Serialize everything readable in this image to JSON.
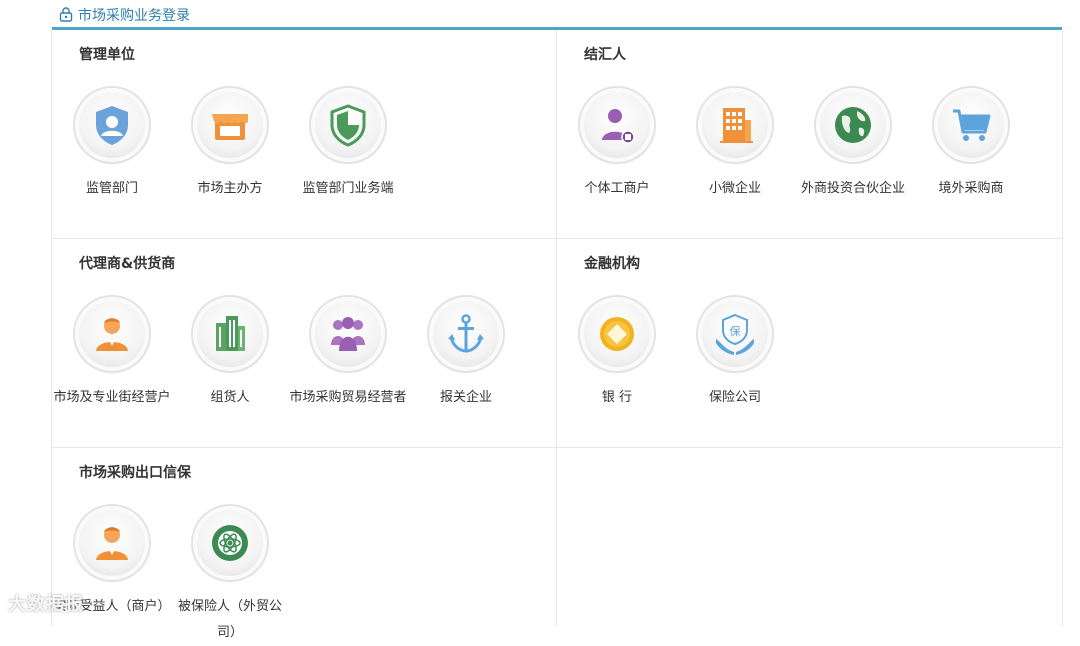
{
  "header": {
    "title": "市场采购业务登录",
    "icon": "lock-icon"
  },
  "sections": {
    "management": {
      "title": "管理单位",
      "items": [
        {
          "label": "监管部门",
          "icon": "shield-user-icon"
        },
        {
          "label": "市场主办方",
          "icon": "storefront-icon"
        },
        {
          "label": "监管部门业务端",
          "icon": "shield-check-icon"
        }
      ]
    },
    "settlement": {
      "title": "结汇人",
      "items": [
        {
          "label": "个体工商户",
          "icon": "businessperson-icon"
        },
        {
          "label": "小微企业",
          "icon": "building-icon"
        },
        {
          "label": "外商投资合伙企业",
          "icon": "globe-icon"
        },
        {
          "label": "境外采购商",
          "icon": "shopping-cart-icon"
        }
      ]
    },
    "agents": {
      "title": "代理商&供货商",
      "items": [
        {
          "label": "市场及专业街经营户",
          "icon": "person-icon"
        },
        {
          "label": "组货人",
          "icon": "office-tower-icon"
        },
        {
          "label": "市场采购贸易经营者",
          "icon": "group-icon"
        },
        {
          "label": "报关企业",
          "icon": "anchor-icon"
        }
      ]
    },
    "finance": {
      "title": "金融机构",
      "items": [
        {
          "label": "银 行",
          "icon": "coin-icon"
        },
        {
          "label": "保险公司",
          "icon": "insurance-hands-icon"
        }
      ]
    },
    "credit": {
      "title": "市场采购出口信保",
      "items": [
        {
          "label": "实际受益人（商户）",
          "icon": "person-icon"
        },
        {
          "label": "被保险人（外贸公司）",
          "icon": "eco-globe-icon"
        }
      ]
    }
  },
  "watermark": "大数据报",
  "colors": {
    "accent": "#4da6c9",
    "title_blue": "#2d7fb0"
  }
}
